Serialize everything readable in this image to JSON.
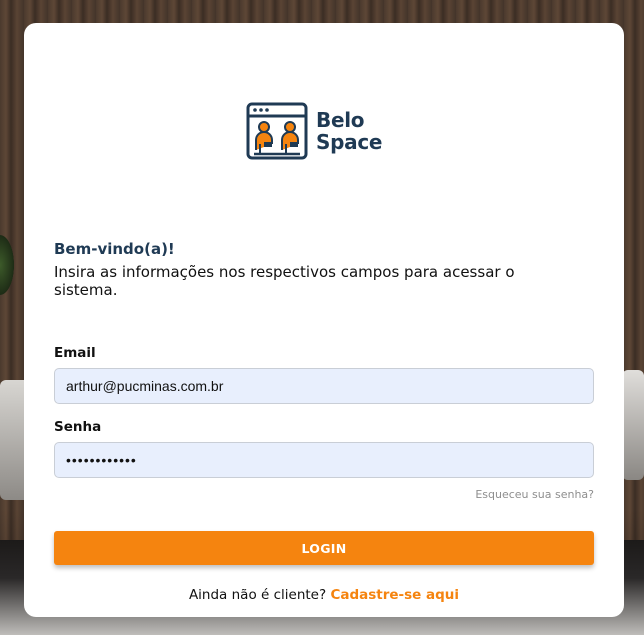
{
  "brand": {
    "name_line1": "Belo",
    "name_line2": "Space",
    "logo_icon": "coworking-window-icon",
    "primary_color": "#1f3a54",
    "accent_color": "#f5840f"
  },
  "header": {
    "welcome": "Bem-vindo(a)!",
    "instructions": "Insira as informações nos respectivos campos para acessar o sistema."
  },
  "form": {
    "email_label": "Email",
    "email_value": "arthur@pucminas.com.br",
    "password_label": "Senha",
    "password_value": "••••••••••••",
    "forgot_password": "Esqueceu sua senha?",
    "login_button": "LOGIN"
  },
  "footer": {
    "prompt": "Ainda não é cliente?",
    "signup_link": "Cadastre-se aqui"
  }
}
